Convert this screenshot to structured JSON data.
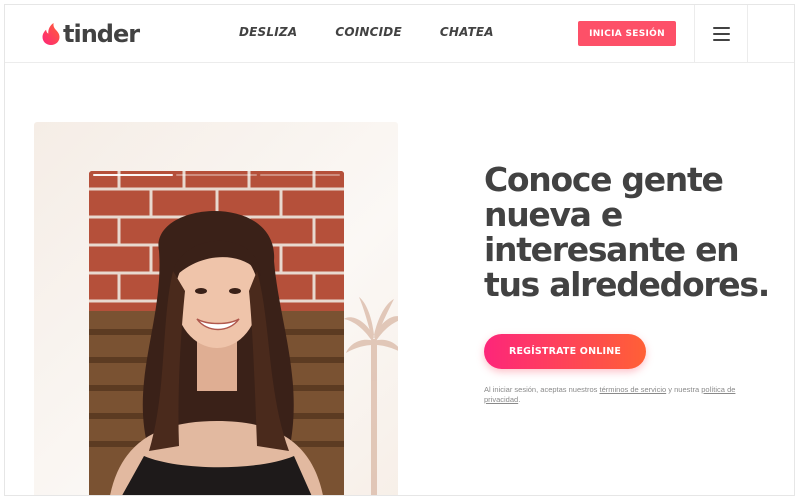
{
  "brand": {
    "name": "tinder",
    "icon": "flame-icon",
    "color": "#fd5068"
  },
  "nav": {
    "items": [
      {
        "label": "DESLIZA"
      },
      {
        "label": "COINCIDE"
      },
      {
        "label": "CHATEA"
      }
    ]
  },
  "header": {
    "login_label": "INICIA SESIÓN",
    "menu_icon": "hamburger-menu-icon"
  },
  "hero": {
    "headline": "Conoce gente nueva e interesante en tus alrededores.",
    "signup_label": "REGÍSTRATE ONLINE",
    "legal_prefix": "Al iniciar sesión, aceptas nuestros ",
    "legal_terms_link": "términos de servicio",
    "legal_middle": " y nuestra ",
    "legal_privacy_link": "política de privacidad",
    "legal_suffix": "."
  },
  "colors": {
    "gradient_start": "#fd267a",
    "gradient_end": "#ff6036",
    "text_dark": "#424242"
  }
}
